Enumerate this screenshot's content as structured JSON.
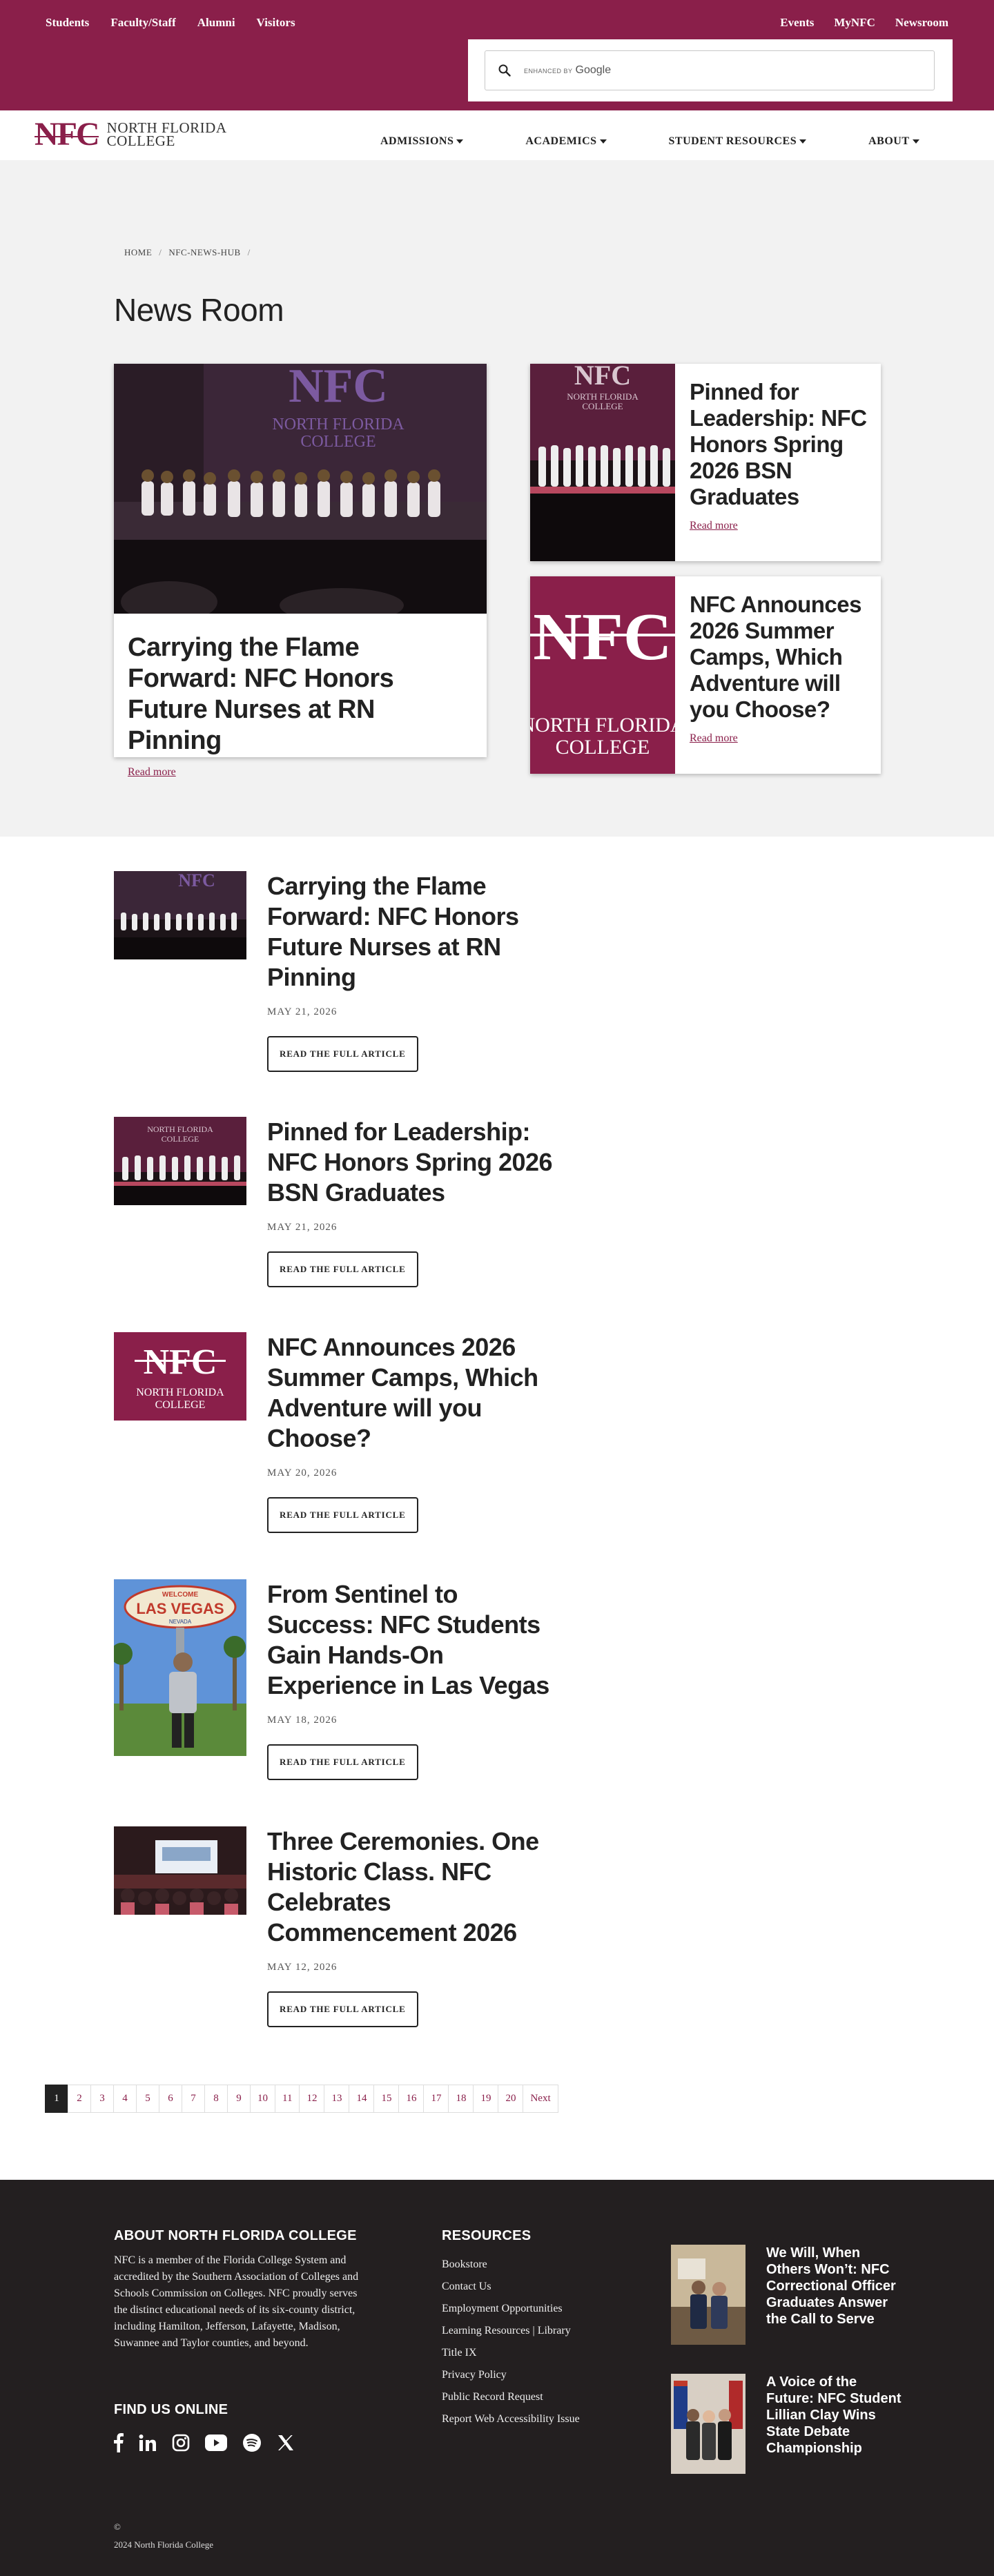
{
  "top_links_left": [
    "Students",
    "Faculty/Staff",
    "Alumni",
    "Visitors"
  ],
  "top_links_right": [
    "Events",
    "MyNFC",
    "Newsroom"
  ],
  "search": {
    "brand_small": "ENHANCED BY",
    "brand_google": "Google"
  },
  "logo": {
    "mark": "NFC",
    "line1": "North Florida",
    "line2": "College"
  },
  "nav": [
    "ADMISSIONS",
    "ACADEMICS",
    "STUDENT RESOURCES",
    "ABOUT"
  ],
  "breadcrumb": [
    "HOME",
    "NFC-NEWS-HUB"
  ],
  "page_title": "News Room",
  "featured": {
    "main": {
      "title": "Carrying the Flame Forward: NFC Honors Future Nurses at RN Pinning",
      "link": "Read more"
    },
    "side": [
      {
        "title": "Pinned for Leadership: NFC Honors Spring 2026 BSN Graduates",
        "link": "Read more"
      },
      {
        "title": "NFC Announces 2026 Summer Camps, Which Adventure will you Choose?",
        "link": "Read more"
      }
    ]
  },
  "articles": [
    {
      "title": "Carrying the Flame Forward: NFC Honors Future Nurses at RN Pinning",
      "date": "MAY 21, 2026",
      "button": "READ THE FULL ARTICLE"
    },
    {
      "title": "Pinned for Leadership: NFC Honors Spring 2026 BSN Graduates",
      "date": "MAY 21, 2026",
      "button": "READ THE FULL ARTICLE"
    },
    {
      "title": "NFC Announces 2026 Summer Camps, Which Adventure will you Choose?",
      "date": "MAY 20, 2026",
      "button": "READ THE FULL ARTICLE"
    },
    {
      "title": "From Sentinel to Success: NFC Students Gain Hands-On Experience in Las Vegas",
      "date": "MAY 18, 2026",
      "button": "READ THE FULL ARTICLE"
    },
    {
      "title": "Three Ceremonies. One Historic Class. NFC Celebrates Commencement 2026",
      "date": "MAY 12, 2026",
      "button": "READ THE FULL ARTICLE"
    }
  ],
  "image_text": {
    "nfc": "NFC",
    "college_line1": "NORTH FLORIDA",
    "college_line2": "COLLEGE",
    "vegas_welcome": "WELCOME",
    "vegas_name": "LAS VEGAS",
    "vegas_state": "NEVADA"
  },
  "pagination": {
    "pages": [
      "1",
      "2",
      "3",
      "4",
      "5",
      "6",
      "7",
      "8",
      "9",
      "10",
      "11",
      "12",
      "13",
      "14",
      "15",
      "16",
      "17",
      "18",
      "19",
      "20"
    ],
    "next": "Next",
    "current": "1"
  },
  "footer": {
    "about_heading": "ABOUT NORTH FLORIDA COLLEGE",
    "about_text": "NFC is a member of the Florida College System and accredited by the Southern Association of Colleges and Schools Commission on Colleges. NFC proudly serves the distinct educational needs of its six-county district, including Hamilton, Jefferson, Lafayette, Madison, Suwannee and Taylor counties, and beyond.",
    "social_heading": "FIND US ONLINE",
    "resources_heading": "RESOURCES",
    "resources": [
      "Bookstore",
      "Contact Us",
      "Employment Opportunities",
      "Learning Resources | Library",
      "Title IX",
      "Privacy Policy",
      "Public Record Request",
      "Report Web Accessibility Issue"
    ],
    "news": [
      "We Will, When Others Won’t: NFC Correctional Officer Graduates Answer the Call to Serve",
      "A Voice of the Future: NFC Student Lillian Clay Wins State Debate Championship"
    ],
    "copyright_symbol": "©",
    "copyright": "2024 North Florida College"
  },
  "colors": {
    "brand": "#8a1f4a",
    "footer_bg": "#231f20",
    "hero_bg": "#f2f2f2"
  }
}
